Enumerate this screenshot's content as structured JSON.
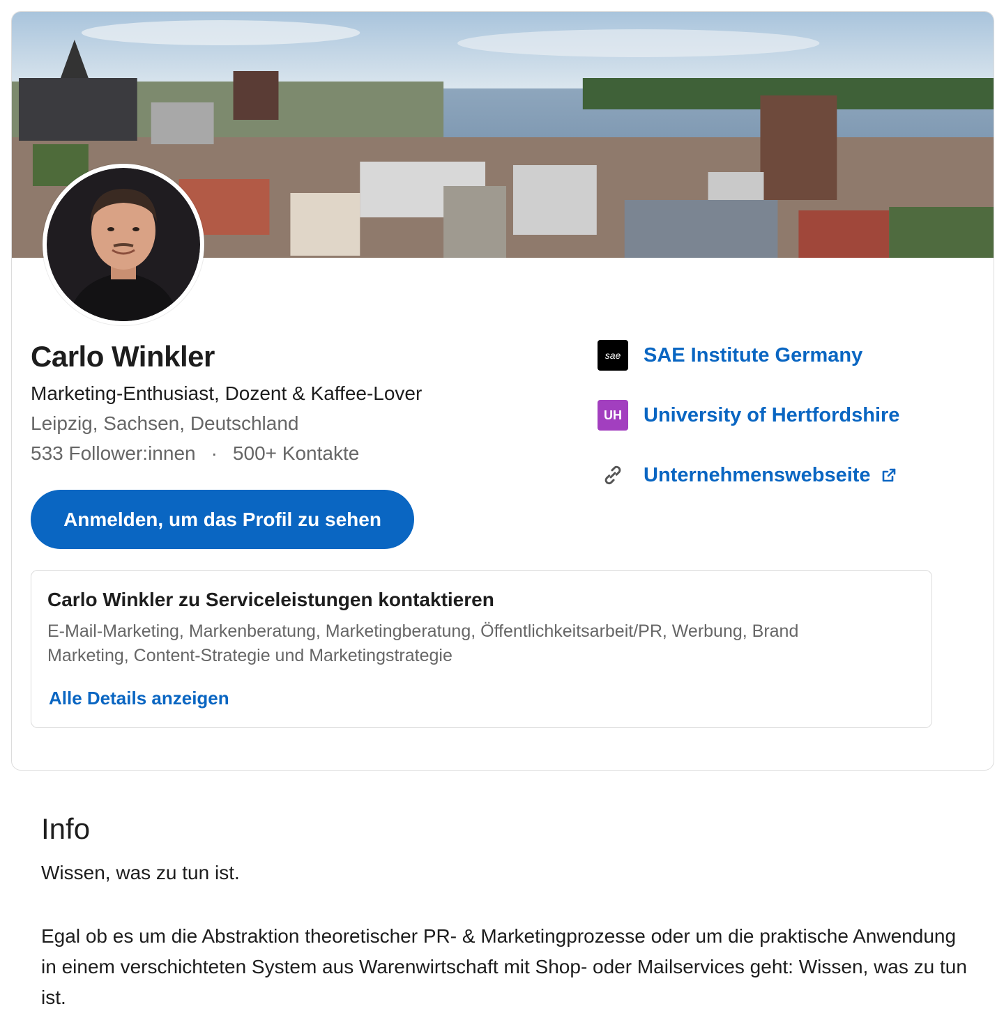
{
  "profile": {
    "name": "Carlo Winkler",
    "headline": "Marketing-Enthusiast, Dozent & Kaffee-Lover",
    "location": "Leipzig, Sachsen, Deutschland",
    "followers": "533 Follower:innen",
    "separator": "·",
    "connections": "500+ Kontakte",
    "signin_label": "Anmelden, um das Profil zu sehen"
  },
  "side_links": [
    {
      "label": "SAE Institute Germany",
      "icon": "sae-logo-icon",
      "logo_text": "sae"
    },
    {
      "label": "University of Hertfordshire",
      "icon": "uh-logo-icon",
      "logo_text": "UH"
    },
    {
      "label": "Unternehmenswebseite",
      "icon": "link-icon"
    }
  ],
  "services": {
    "title": "Carlo Winkler zu Serviceleistungen kontaktieren",
    "description": "E-Mail-Marketing, Markenberatung, Marketingberatung, Öffentlichkeitsarbeit/PR, Werbung, Brand Marketing, Content-Strategie und Marketingstrategie",
    "details_link": "Alle Details anzeigen"
  },
  "info": {
    "title": "Info",
    "paragraph1": "Wissen, was zu tun ist.",
    "paragraph2": "Egal ob es um die Abstraktion theoretischer PR- & Marketingprozesse oder um die praktische Anwendung in einem verschichteten System aus Warenwirtschaft mit Shop- oder Mailservices geht: Wissen, was zu tun ist."
  },
  "colors": {
    "brand_blue": "#0a66c2",
    "uh_purple": "#a23fbf",
    "muted_text": "#666666"
  }
}
